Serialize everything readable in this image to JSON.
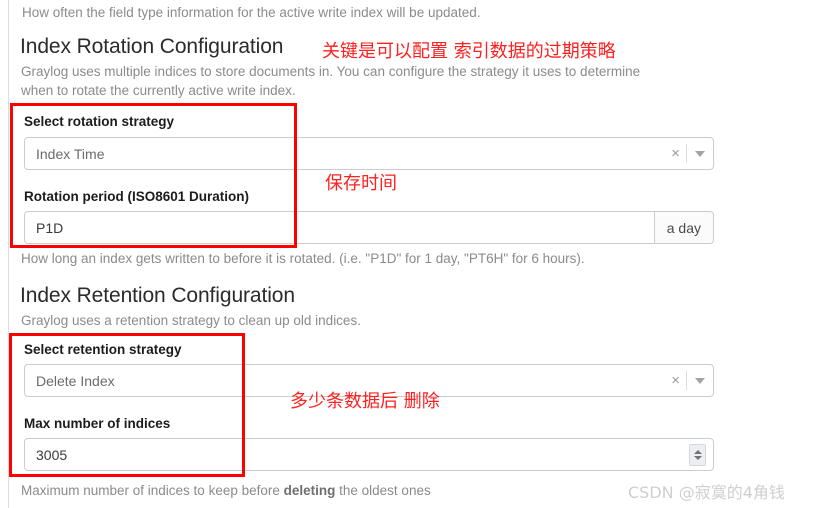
{
  "page": {
    "top_help_text": "How often the field type information for the active write index will be updated."
  },
  "rotation_section": {
    "title": "Index Rotation Configuration",
    "description_line1": "Graylog uses multiple indices to store documents in. You can configure the strategy it uses to determine",
    "description_line2": "when to rotate the currently active write index.",
    "strategy_label": "Select rotation strategy",
    "strategy_value": "Index Time",
    "clear_icon": "×",
    "period_label": "Rotation period (ISO8601 Duration)",
    "period_value": "P1D",
    "period_addon": "a day",
    "period_help": "How long an index gets written to before it is rotated. (i.e. \"P1D\" for 1 day, \"PT6H\" for 6 hours)."
  },
  "retention_section": {
    "title": "Index Retention Configuration",
    "description": "Graylog uses a retention strategy to clean up old indices.",
    "strategy_label": "Select retention strategy",
    "strategy_value": "Delete Index",
    "clear_icon": "×",
    "max_indices_label": "Max number of indices",
    "max_indices_value": "3005",
    "max_indices_help_before": "Maximum number of indices to keep before ",
    "max_indices_help_bold": "deleting",
    "max_indices_help_after": " the oldest ones"
  },
  "annotations": {
    "rotation_note": "关键是可以配置 索引数据的过期策略",
    "period_note": "保存时间",
    "retention_note": "多少条数据后 删除",
    "box_color": "#ff0000",
    "text_color": "#ff2020"
  },
  "watermark": {
    "text": "CSDN @寂寞的4角钱"
  }
}
